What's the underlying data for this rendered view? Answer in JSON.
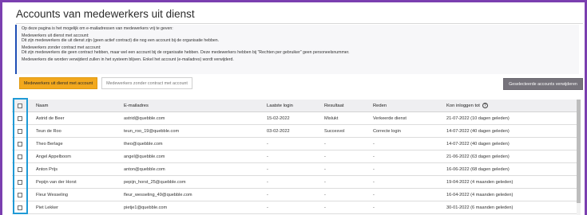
{
  "page": {
    "title": "Accounts van medewerkers uit dienst"
  },
  "info": {
    "lines": [
      "Op deze pagina is het mogelijk om e-mailadressen van medewerkers vrij te geven:",
      "",
      "Medewerkers uit dienst met account:",
      "Dit zijn medewerkers die uit dienst zijn (geen actief contract) die nog een account bij de organisatie hebben.",
      "",
      "Medewerkers zonder contract met account:",
      "Dit zijn medewerkers die geen contract hebben, maar wel een account bij de organisatie hebben. Deze medewerkers hebben bij \"Rechten per gebruiker\" geen personeelsnummer.",
      "",
      "Medewerkers die worden verwijderd zullen in het systeem blijven. Enkel het account (e-mailadres) wordt verwijderd."
    ]
  },
  "buttons": {
    "active_tab": "Medewerkers uit dienst met account",
    "inactive_tab": "Medewerkers zonder contract met account",
    "delete": "Geselecteerde accounts verwijderen"
  },
  "table": {
    "headers": {
      "name": "Naam",
      "email": "E-mailadres",
      "last_login": "Laatste login",
      "result": "Resultaat",
      "reason": "Reden",
      "can_login_until": "Kon inloggen tot",
      "help_icon": "?"
    },
    "rows": [
      {
        "name": "Astrid de Beer",
        "email": "astrid@quebble.com",
        "last_login": "15-02-2022",
        "result": "Mislukt",
        "reason": "Verkeerde dienst",
        "until": "21-07-2022 (10 dagen geleden)"
      },
      {
        "name": "Teun de Roo",
        "email": "teun_roo_19@quebble.com",
        "last_login": "03-02-2022",
        "result": "Succesvol",
        "reason": "Correcte login",
        "until": "14-07-2022 (40 dagen geleden)"
      },
      {
        "name": "Theo Berlage",
        "email": "theo@quebble.com",
        "last_login": "-",
        "result": "-",
        "reason": "-",
        "until": "14-07-2022 (40 dagen geleden)"
      },
      {
        "name": "Angel Appelboom",
        "email": "angel@quebble.com",
        "last_login": "-",
        "result": "-",
        "reason": "-",
        "until": "21-06-2022 (63 dagen geleden)"
      },
      {
        "name": "Anton Prijs",
        "email": "anton@quebble.com",
        "last_login": "-",
        "result": "-",
        "reason": "-",
        "until": "16-06-2022 (68 dagen geleden)"
      },
      {
        "name": "Pepijn van der Horst",
        "email": "pepijn_horst_25@quebble.com",
        "last_login": "-",
        "result": "-",
        "reason": "-",
        "until": "19-04-2022 (4 maanden geleden)"
      },
      {
        "name": "Fleur Wesseling",
        "email": "fleur_wesseling_49@quebble.com",
        "last_login": "-",
        "result": "-",
        "reason": "-",
        "until": "16-04-2022 (4 maanden geleden)"
      },
      {
        "name": "Piet Lekker",
        "email": "pietje1@quebble.com",
        "last_login": "-",
        "result": "-",
        "reason": "-",
        "until": "30-01-2022 (6 maanden geleden)"
      }
    ]
  },
  "colors": {
    "frame": "#7b3fb0",
    "highlight": "#1f9ad6",
    "active_button": "#f2a81d",
    "delete_button": "#76737b"
  }
}
